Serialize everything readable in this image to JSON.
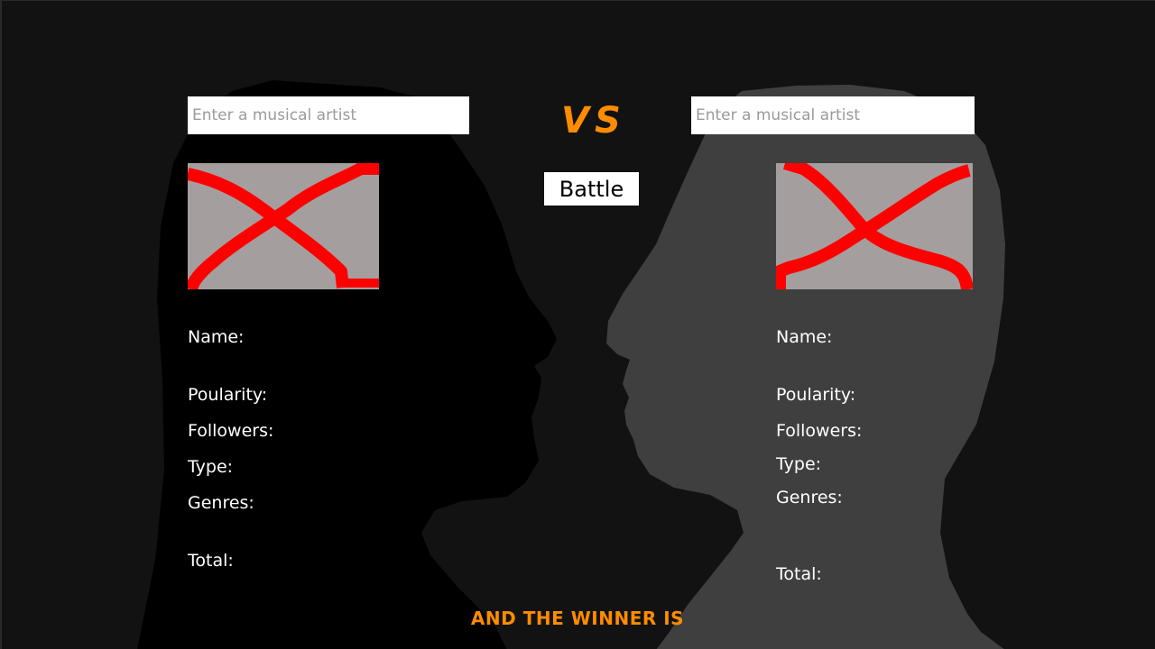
{
  "left_artist": {
    "input_placeholder": "Enter a musical artist",
    "image_alt": "broken-image",
    "stats": {
      "name_label": "Name:",
      "popularity_label": "Poularity:",
      "followers_label": "Followers:",
      "type_label": "Type:",
      "genres_label": "Genres:",
      "total_label": "Total:"
    }
  },
  "center": {
    "vs_label": "VS",
    "battle_label": "Battle"
  },
  "right_artist": {
    "input_placeholder": "Enter a musical artist",
    "image_alt": "broken-image",
    "stats": {
      "name_label": "Name:",
      "popularity_label": "Poularity:",
      "followers_label": "Followers:",
      "type_label": "Type:",
      "genres_label": "Genres:",
      "total_label": "Total:"
    }
  },
  "footer": {
    "winner_label": "AND THE WINNER IS"
  },
  "colors": {
    "background": "#121212",
    "left_silhouette": "#000000",
    "right_silhouette": "#3f3f3f",
    "accent": "#ff8c00",
    "broken_image_fill": "#a49f9e",
    "broken_image_cross": "#ff0000"
  }
}
